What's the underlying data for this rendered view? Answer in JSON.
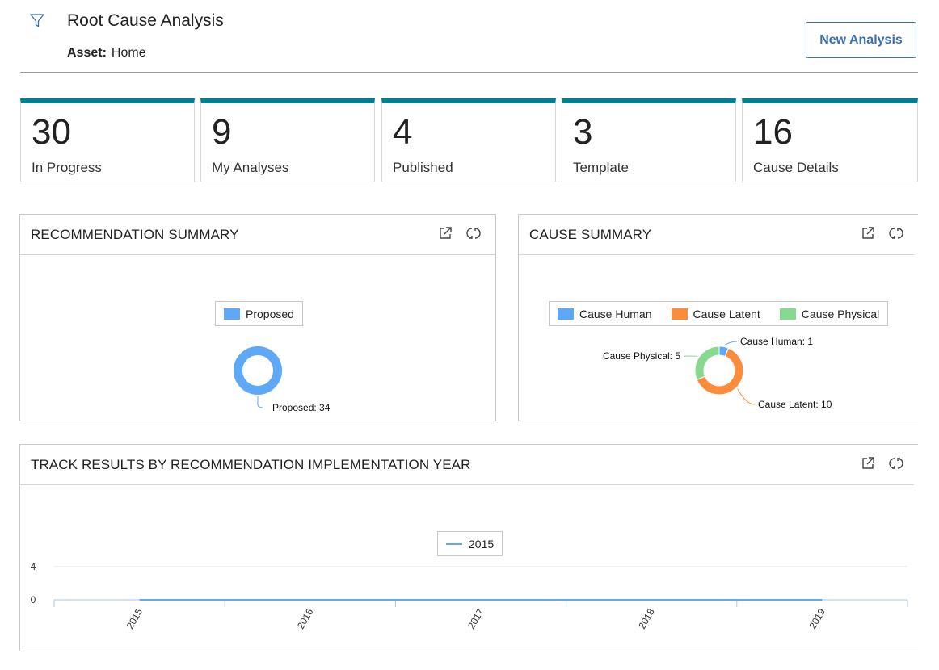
{
  "header": {
    "title": "Root Cause Analysis",
    "asset_label": "Asset:",
    "asset_value": "Home",
    "new_button": "New Analysis",
    "filter_icon": "filter-icon"
  },
  "tiles": [
    {
      "count": "30",
      "label": "In Progress"
    },
    {
      "count": "9",
      "label": "My Analyses"
    },
    {
      "count": "4",
      "label": "Published"
    },
    {
      "count": "3",
      "label": "Template"
    },
    {
      "count": "16",
      "label": "Cause Details"
    }
  ],
  "colors": {
    "accent": "#007f8f",
    "button": "#3a6fb5",
    "proposed": "#5ea8f5",
    "cause_human": "#5ea8f5",
    "cause_latent": "#fb8c3c",
    "cause_physical": "#86d98f"
  },
  "panels": {
    "recommendation": {
      "title": "RECOMMENDATION SUMMARY",
      "icons": [
        "external-link-icon",
        "refresh-icon"
      ]
    },
    "cause": {
      "title": "CAUSE SUMMARY",
      "icons": [
        "external-link-icon",
        "refresh-icon"
      ]
    },
    "track": {
      "title": "TRACK RESULTS BY RECOMMENDATION IMPLEMENTATION YEAR",
      "icons": [
        "external-link-icon",
        "refresh-icon"
      ]
    }
  },
  "chart_data": [
    {
      "type": "pie",
      "title": "RECOMMENDATION SUMMARY",
      "donut": true,
      "legend": [
        "Proposed"
      ],
      "slices": [
        {
          "name": "Proposed",
          "value": 34,
          "label": "Proposed: 34"
        }
      ]
    },
    {
      "type": "pie",
      "title": "CAUSE SUMMARY",
      "donut": true,
      "legend": [
        "Cause Human",
        "Cause Latent",
        "Cause Physical"
      ],
      "slices": [
        {
          "name": "Cause Human",
          "value": 1,
          "label": "Cause Human: 1"
        },
        {
          "name": "Cause Latent",
          "value": 10,
          "label": "Cause Latent: 10"
        },
        {
          "name": "Cause Physical",
          "value": 5,
          "label": "Cause Physical: 5"
        }
      ]
    },
    {
      "type": "line",
      "title": "TRACK RESULTS BY RECOMMENDATION IMPLEMENTATION YEAR",
      "legend_placement": "top-center",
      "categories": [
        "2015",
        "2016",
        "2017",
        "2018",
        "2019"
      ],
      "series": [
        {
          "name": "2015",
          "values": [
            0,
            0,
            0,
            0,
            0
          ]
        }
      ],
      "yticks": [
        "4",
        "0"
      ],
      "ylim": [
        0,
        4
      ],
      "grid": true
    }
  ]
}
